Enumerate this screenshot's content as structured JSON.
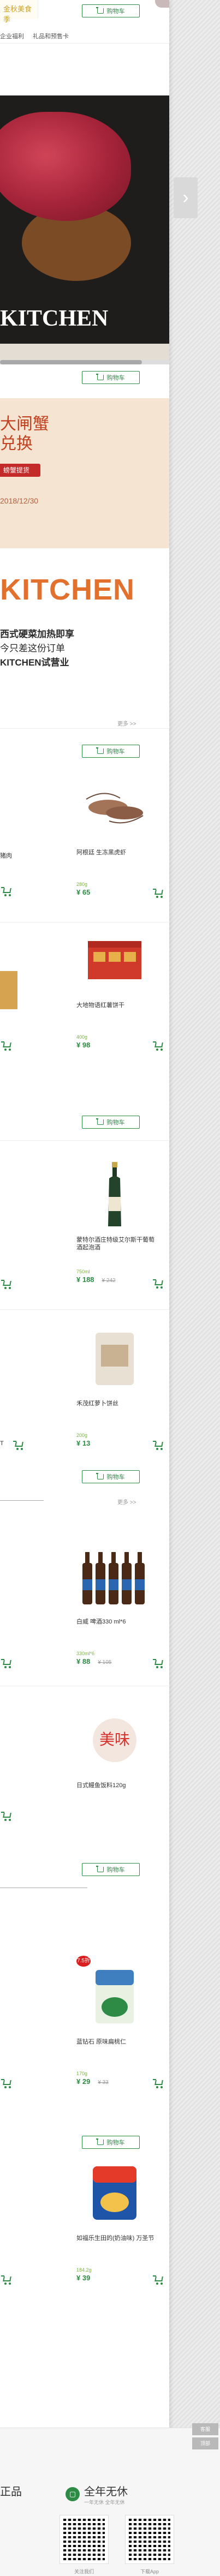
{
  "topbar": {
    "logo_text": "金秋美食季",
    "cart_label": "购物车",
    "nav": [
      "企业福利",
      "礼品和预售卡"
    ]
  },
  "hero": {
    "headline": "KITCHEN"
  },
  "crab_promo": {
    "title_line1": "大闸蟹",
    "title_line2": "兑换",
    "button": "螃蟹提货",
    "date": "2018/12/30"
  },
  "kitchen_promo": {
    "word": "KITCHEN",
    "line1": "西式硬菜加热即享",
    "line2": "今只差这份订单",
    "line3": "KITCHEN试营业"
  },
  "sections": {
    "more_label": "更多 >>",
    "cart_label": "购物车"
  },
  "products": [
    {
      "name": "阿根廷 生冻黑虎虾",
      "meta": "280g",
      "price": "¥ 65",
      "old": "",
      "img": "shrimp"
    },
    {
      "name": "大地物语红薯饼干",
      "meta": "400g",
      "price": "¥ 98",
      "old": "",
      "img": "giftbox"
    },
    {
      "name": "蒙特尔酒庄特级艾尔斯干葡萄酒起泡酒",
      "meta": "750ml",
      "price": "¥ 188",
      "old": "¥ 242",
      "img": "wine"
    },
    {
      "name": "禾茂红萝卜饼丝",
      "meta": "200g",
      "price": "¥ 13",
      "old": "",
      "img": "bag"
    },
    {
      "name": "白威 啤酒330 ml*6",
      "meta": "330ml*6",
      "price": "¥ 88",
      "old": "¥ 105",
      "img": "beer"
    },
    {
      "name": "日式鳗鱼饭料120g",
      "meta": "",
      "price": "",
      "old": "",
      "img": "snack"
    },
    {
      "name": "蓝钻石 原味扁桃仁",
      "meta": "170g",
      "price": "¥ 29",
      "old": "¥ 33",
      "img": "almond"
    },
    {
      "name": "如福乐生田的(奶油味) 万圣节",
      "meta": "184.2g",
      "price": "¥ 39",
      "old": "",
      "img": "chips"
    }
  ],
  "left_snips": [
    "猪肉",
    "A类",
    "T"
  ],
  "badge_new": "7.5折",
  "footer": {
    "feature_left": "正品",
    "feature_right": "全年无休",
    "feature_right_sub": "一年无休 全年无休",
    "qr1_label": "关注我们",
    "qr2_label": "下载App",
    "side_tabs": [
      "客服",
      "顶部"
    ]
  }
}
